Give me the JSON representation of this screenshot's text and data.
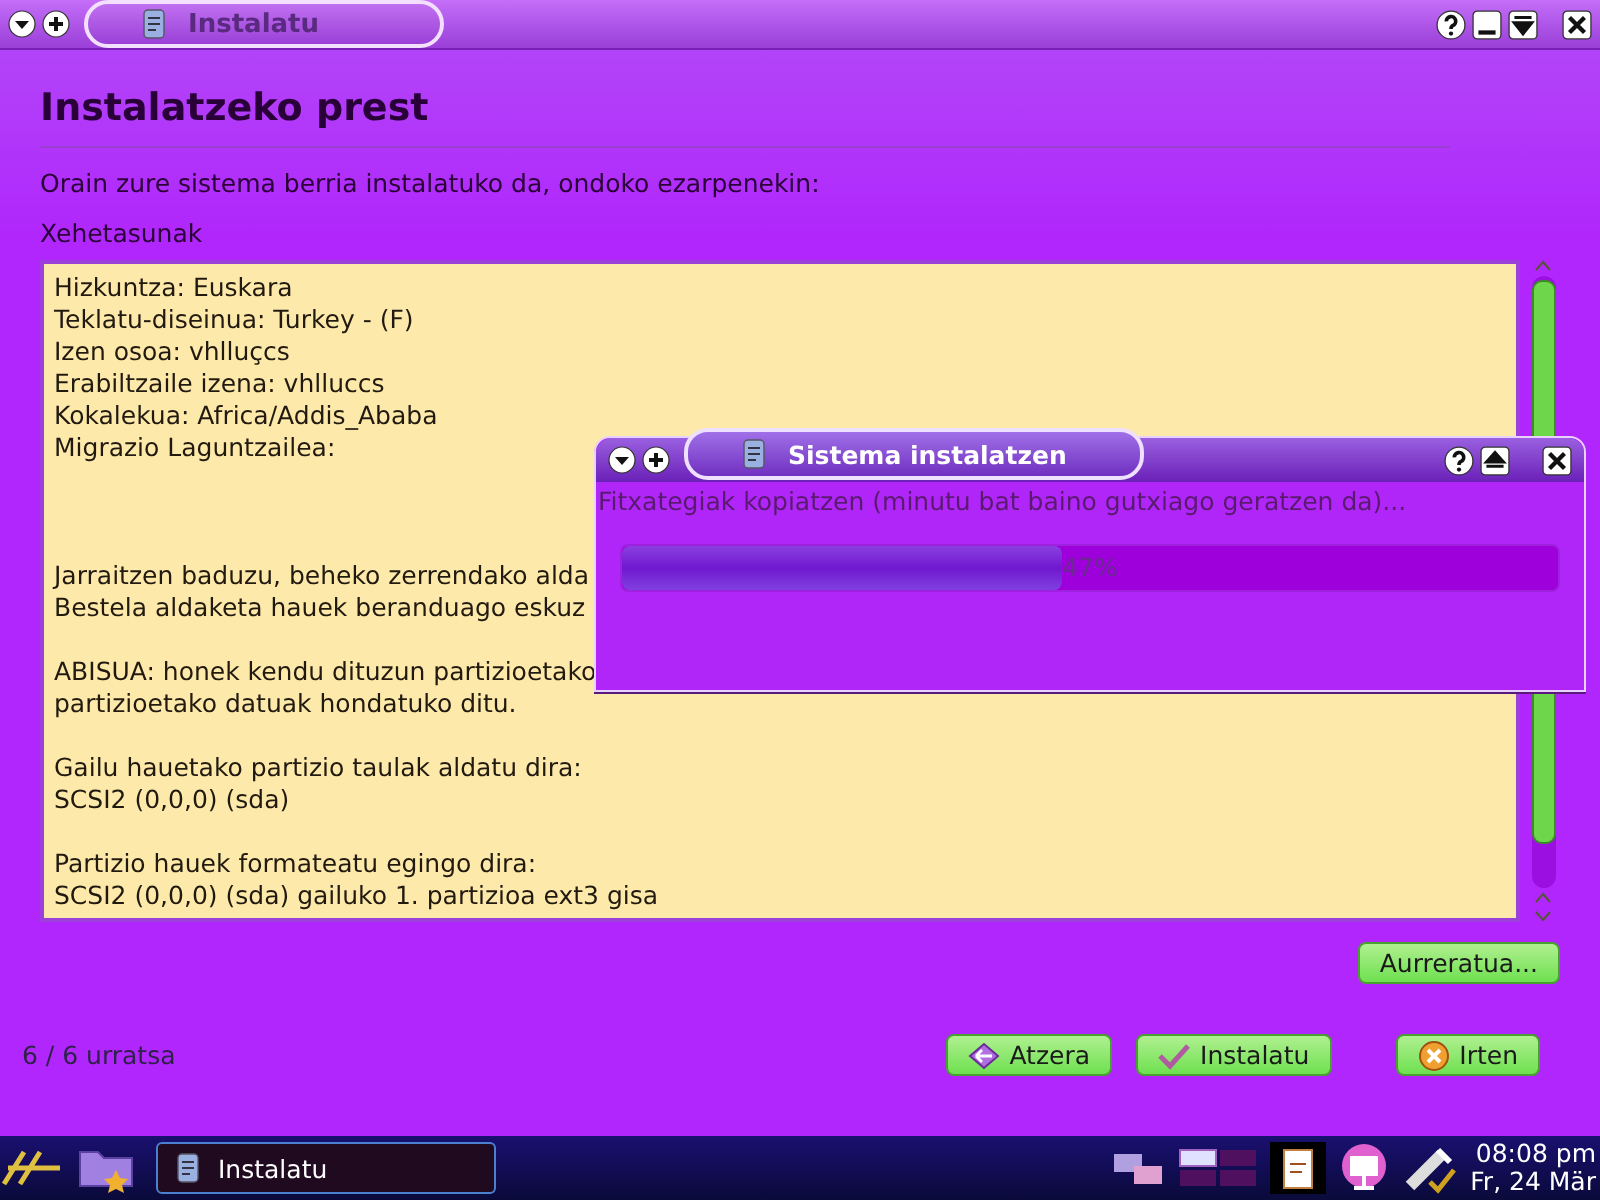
{
  "window": {
    "title": "Instalatu"
  },
  "page": {
    "heading": "Instalatzeko prest",
    "intro": "Orain zure sistema berria instalatuko da, ondoko ezarpenekin:",
    "details_label": "Xehetasunak"
  },
  "details": [
    [
      "Hizkuntza: Euskara",
      "Teklatu-diseinua: Turkey - (F)",
      "Izen osoa: vhlluçcs",
      "Erabiltzaile izena: vhlluccs",
      "Kokalekua: Africa/Addis_Ababa",
      "Migrazio Laguntzailea:"
    ],
    [
      "Jarraitzen baduzu, beheko zerrendako alda",
      "Bestela aldaketa hauek beranduago eskuz"
    ],
    [
      "ABISUA: honek kendu dituzun partizioetako",
      "partizioetako datuak hondatuko ditu."
    ],
    [
      "Gailu hauetako partizio taulak aldatu dira:",
      "SCSI2 (0,0,0) (sda)"
    ],
    [
      "Partizio hauek formateatu egingo dira:",
      "SCSI2 (0,0,0) (sda) gailuko 1. partizioa ext3 gisa"
    ]
  ],
  "advanced_button": "Aurreratua...",
  "step": "6 / 6 urratsa",
  "buttons": [
    {
      "kind": "back",
      "label": "Atzera"
    },
    {
      "kind": "install",
      "label": "Instalatu"
    },
    {
      "kind": "quit",
      "label": "Irten"
    }
  ],
  "dialog": {
    "title": "Sistema instalatzen",
    "message": "Fitxategiak kopiatzen (minutu bat baino gutxiago geratzen da)...",
    "progress": {
      "level": 0.47,
      "reading": "47%"
    }
  },
  "taskbar": {
    "task": "Instalatu",
    "time": "08:08 pm",
    "date": "Fr, 24 Mär"
  }
}
